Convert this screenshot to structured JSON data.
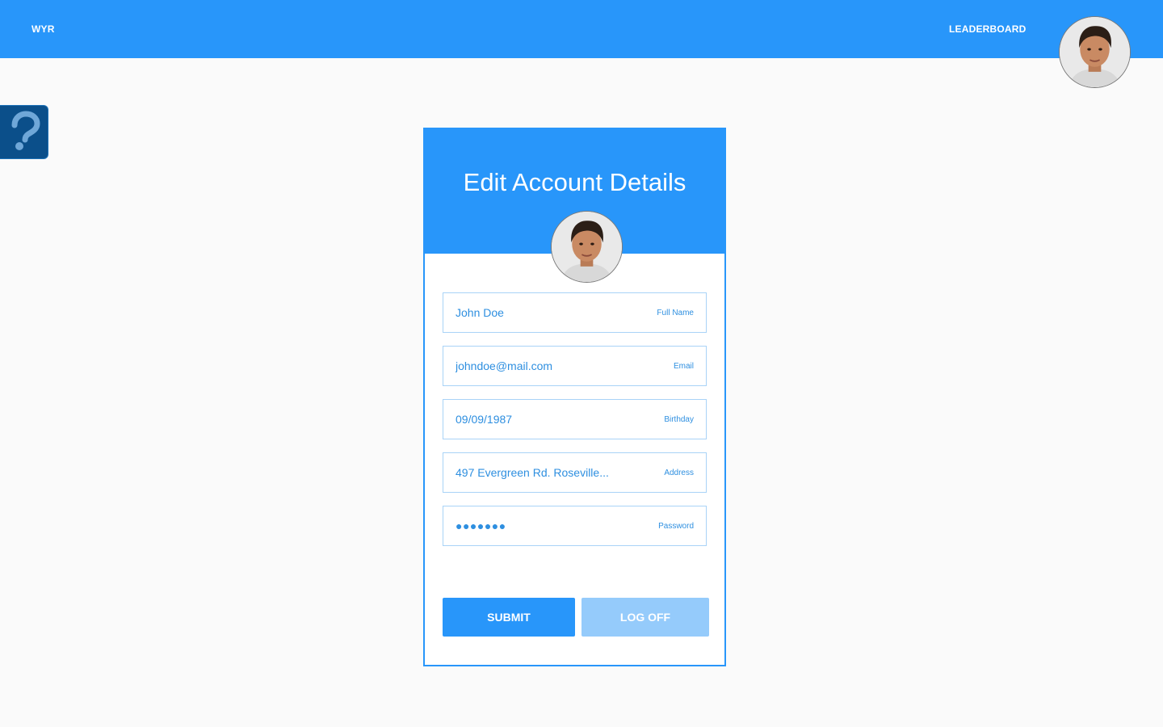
{
  "nav": {
    "brand": "WYR",
    "leaderboard_label": "LEADERBOARD"
  },
  "help": {
    "icon": "question-mark-icon"
  },
  "card": {
    "title": "Edit Account Details",
    "fields": [
      {
        "value": "John Doe",
        "label": "Full Name"
      },
      {
        "value": "johndoe@mail.com",
        "label": "Email"
      },
      {
        "value": "09/09/1987",
        "label": "Birthday"
      },
      {
        "value": "497 Evergreen Rd. Roseville...",
        "label": "Address"
      },
      {
        "value": "●●●●●●●",
        "label": "Password"
      }
    ],
    "submit_label": "SUBMIT",
    "logoff_label": "LOG OFF"
  },
  "colors": {
    "primary": "#2896fa",
    "primary_light": "#95cbfb",
    "help_tab": "#0b4f8a",
    "field_text": "#2e8fe0",
    "background": "#fafafa"
  }
}
